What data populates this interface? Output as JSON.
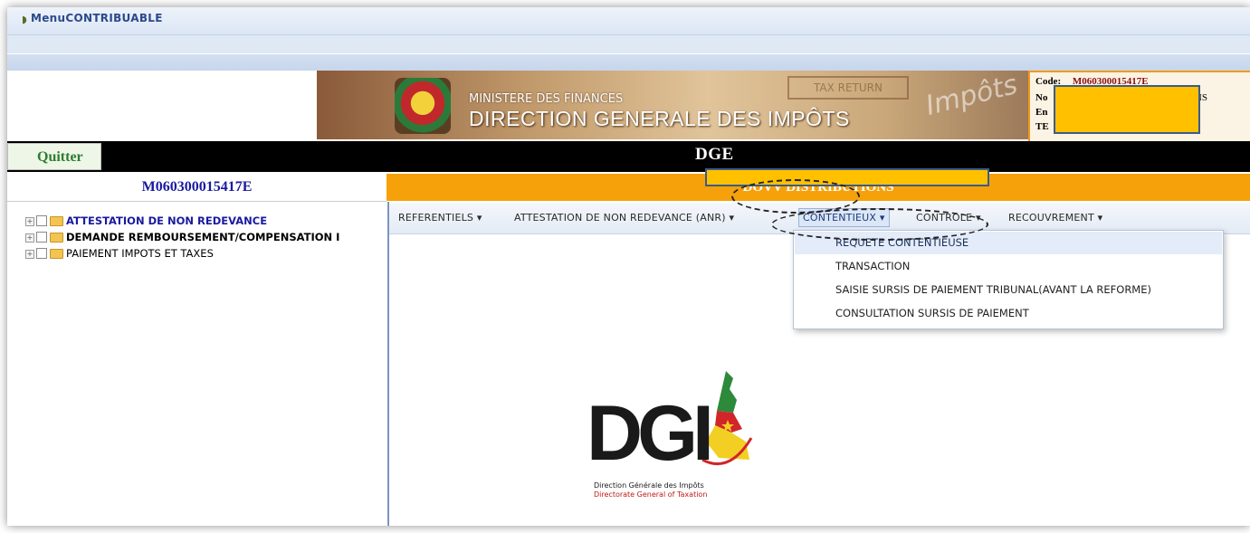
{
  "window": {
    "title": "MenuCONTRIBUABLE"
  },
  "banner": {
    "ministry": "MINISTERE DES FINANCES",
    "directorate": "DIRECTION GENERALE DES IMPÔTS",
    "stamp_text": "TAX RETURN",
    "watermark": "Impôts"
  },
  "info_panel": {
    "code_label": "Code:",
    "code_value": "M060300015417E",
    "nom_label": "No",
    "nom_tail": "ONS",
    "en_label": "En",
    "te_label": "TE"
  },
  "top_bar": {
    "quit_label": "Quitter",
    "title": "DGE"
  },
  "sidebar": {
    "header": "M060300015417E",
    "items": [
      {
        "label": "ATTESTATION DE NON REDEVANCE"
      },
      {
        "label": "DEMANDE REMBOURSEMENT/COMPENSATION I"
      },
      {
        "label": "PAIEMENT IMPOTS ET TAXES"
      }
    ]
  },
  "company": {
    "name": "DOVV DISTRIBUTIONS"
  },
  "menu": {
    "items": [
      {
        "label": "REFERENTIELS ▾"
      },
      {
        "label": "ATTESTATION DE NON REDEVANCE (ANR) ▾"
      },
      {
        "label": "CONTENTIEUX ▾"
      },
      {
        "label": "CONTROLE ▾"
      },
      {
        "label": "RECOUVREMENT ▾"
      }
    ]
  },
  "dropdown": {
    "items": [
      {
        "label": "REQUETE CONTENTIEUSE"
      },
      {
        "label": "TRANSACTION"
      },
      {
        "label": "SAISIE SURSIS DE PAIEMENT TRIBUNAL(AVANT LA REFORME)"
      },
      {
        "label": "CONSULTATION SURSIS DE PAIEMENT"
      }
    ]
  },
  "logo": {
    "text": "DGI",
    "line1": "Direction Générale des Impôts",
    "line2": "Directorate General of Taxation"
  },
  "colors": {
    "accent_orange": "#f7a10a",
    "header_navy": "#1a1aa0",
    "mask_yellow": "#ffc000"
  }
}
